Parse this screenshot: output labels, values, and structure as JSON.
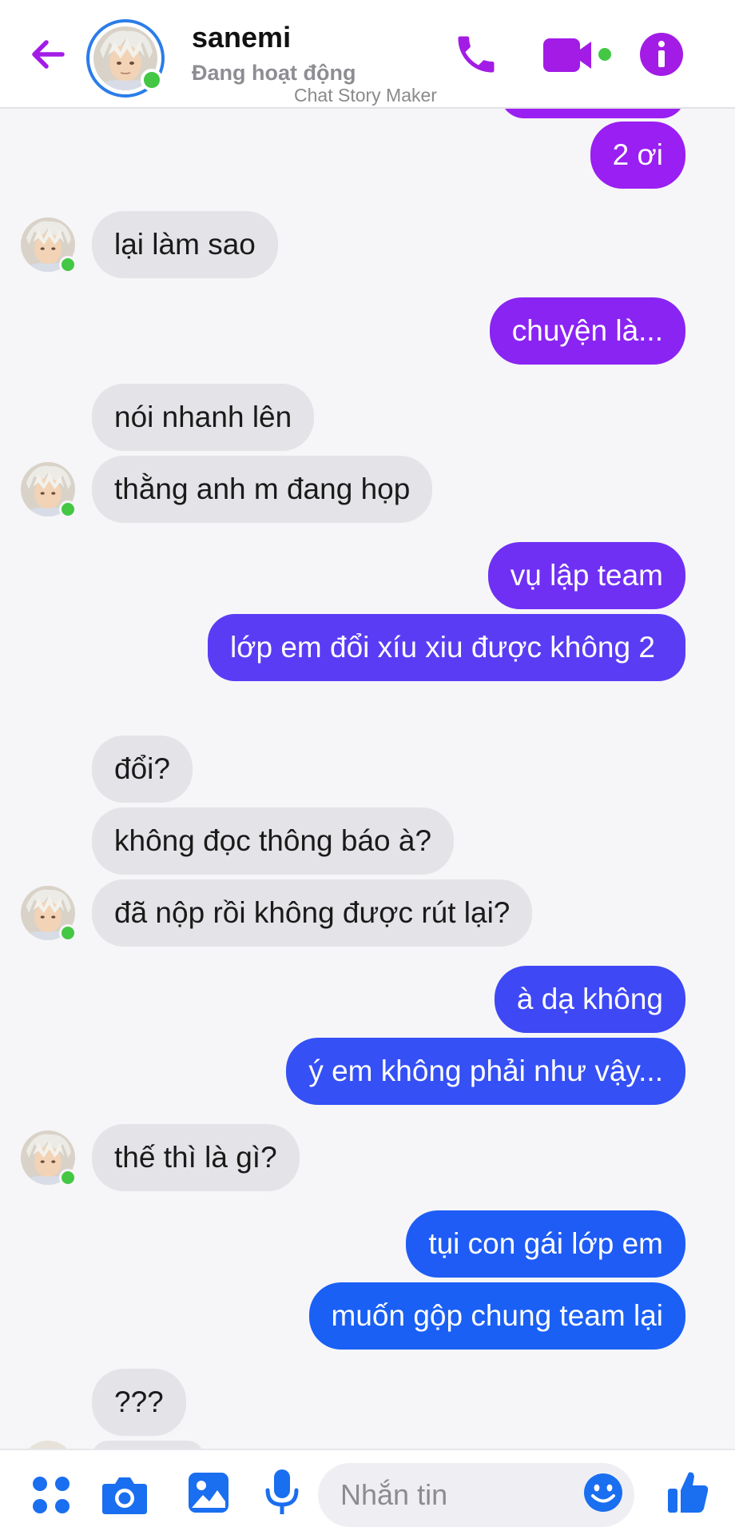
{
  "header": {
    "contact_name": "sanemi",
    "status": "Đang hoạt động",
    "watermark": "Chat Story Maker",
    "icons": [
      "back-arrow-icon",
      "phone-icon",
      "video-camera-icon",
      "info-icon"
    ]
  },
  "messages": [
    {
      "side": "out",
      "text": "2 ơi"
    },
    {
      "side": "in",
      "text": "lại làm sao"
    },
    {
      "side": "out",
      "text": "chuyện là..."
    },
    {
      "side": "in",
      "text": "nói nhanh lên"
    },
    {
      "side": "in",
      "text": "thằng anh m đang họp"
    },
    {
      "side": "out",
      "text": "vụ lập team"
    },
    {
      "side": "out",
      "text": "lớp em đổi xíu xiu được không 2"
    },
    {
      "side": "in",
      "text": "đổi?"
    },
    {
      "side": "in",
      "text": "không đọc thông báo à?"
    },
    {
      "side": "in",
      "text": "đã nộp rồi không được rút lại?"
    },
    {
      "side": "out",
      "text": "à dạ không"
    },
    {
      "side": "out",
      "text": "ý em không phải như vậy..."
    },
    {
      "side": "in",
      "text": "thế thì là gì?"
    },
    {
      "side": "out",
      "text": "tụi con gái lớp em"
    },
    {
      "side": "out",
      "text": "muốn gộp chung team lại"
    },
    {
      "side": "in",
      "text": "???"
    }
  ],
  "composer": {
    "placeholder": "Nhắn tin",
    "icons": [
      "menu-dots-icon",
      "camera-icon",
      "gallery-icon",
      "microphone-icon",
      "emoji-icon",
      "thumbs-up-icon"
    ]
  },
  "colors": {
    "accent_purple": "#a020f0",
    "accent_blue": "#1e5cf5",
    "online_green": "#44c744",
    "incoming_bubble": "#e4e4e8"
  }
}
